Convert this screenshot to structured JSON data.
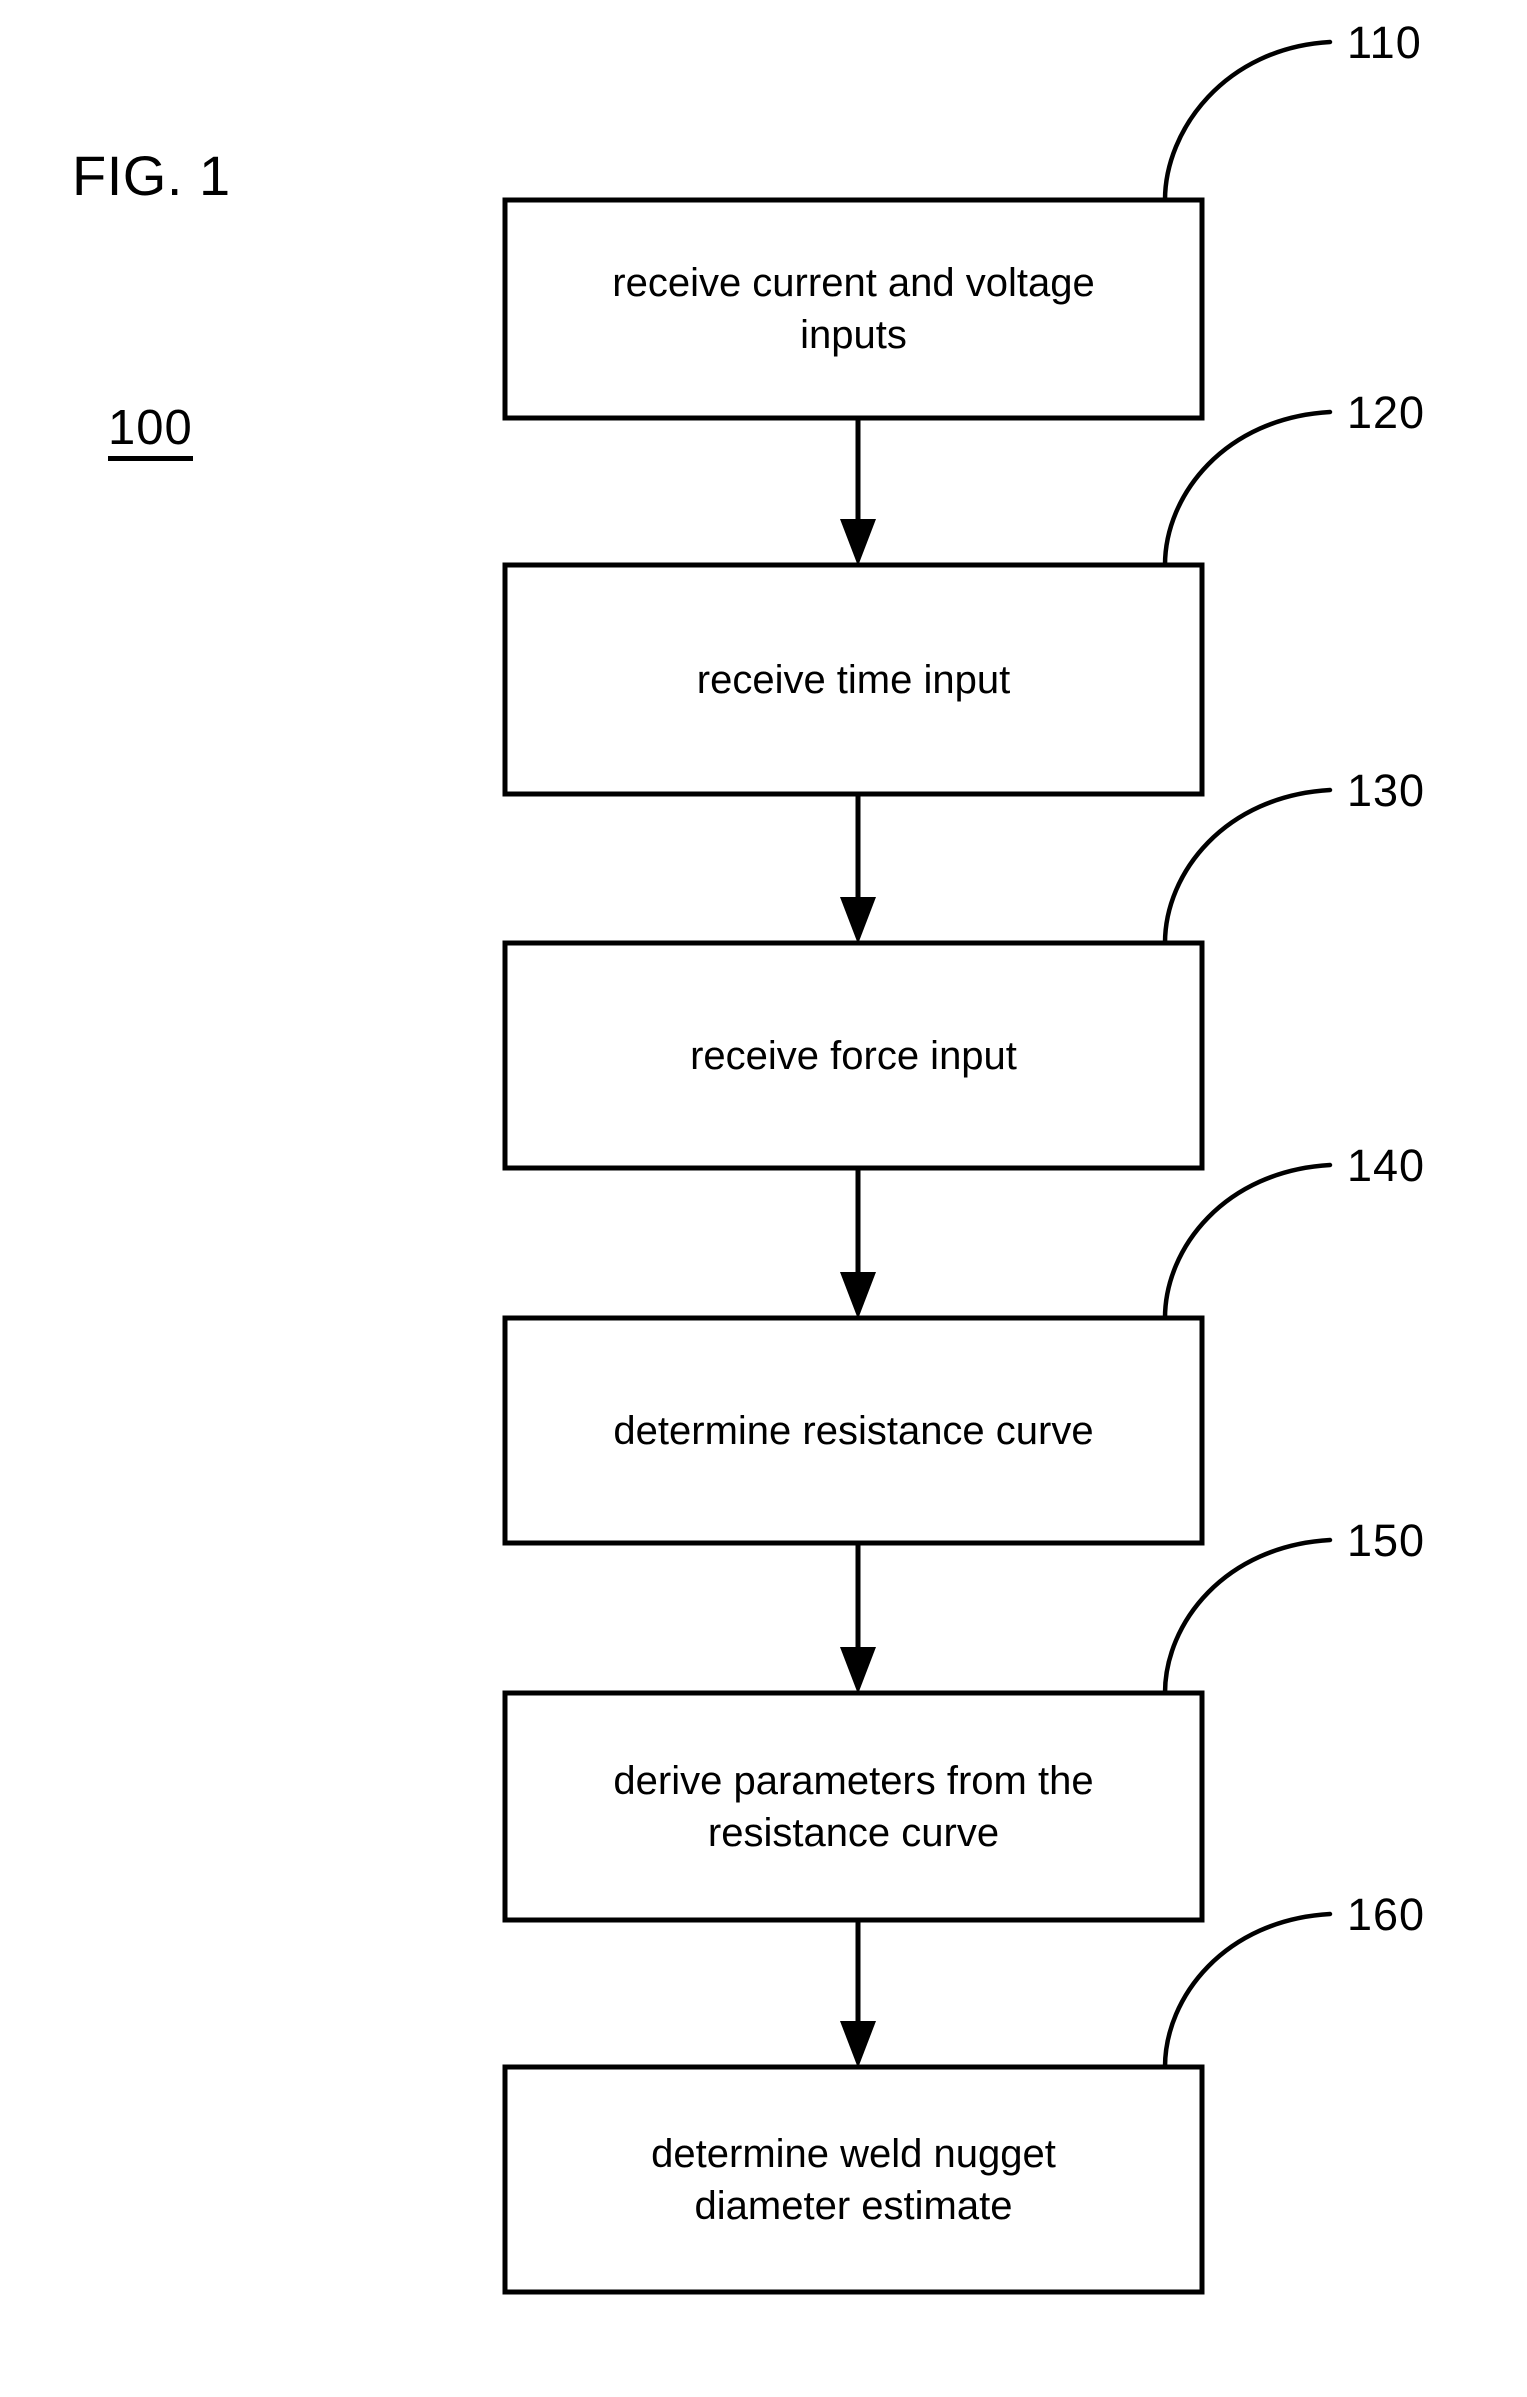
{
  "figure": {
    "caption": "FIG. 1",
    "flow_reference": "100"
  },
  "flowchart": {
    "type": "vertical-flowchart",
    "orientation": "top-to-bottom",
    "steps": [
      {
        "ref": "110",
        "label": "receive current and voltage inputs",
        "lines": [
          "receive current and voltage",
          "inputs"
        ]
      },
      {
        "ref": "120",
        "label": "receive time input",
        "lines": [
          "receive time input"
        ]
      },
      {
        "ref": "130",
        "label": "receive force input",
        "lines": [
          "receive force input"
        ]
      },
      {
        "ref": "140",
        "label": "determine resistance curve",
        "lines": [
          "determine resistance curve"
        ]
      },
      {
        "ref": "150",
        "label": "derive parameters from the resistance curve",
        "lines": [
          "derive parameters from the",
          "resistance curve"
        ]
      },
      {
        "ref": "160",
        "label": "determine weld nugget diameter estimate",
        "lines": [
          "determine weld nugget",
          "diameter estimate"
        ]
      }
    ],
    "connectors": [
      {
        "from": "110",
        "to": "120",
        "style": "arrow-down"
      },
      {
        "from": "120",
        "to": "130",
        "style": "arrow-down"
      },
      {
        "from": "130",
        "to": "140",
        "style": "arrow-down"
      },
      {
        "from": "140",
        "to": "150",
        "style": "arrow-down"
      },
      {
        "from": "150",
        "to": "160",
        "style": "arrow-down"
      }
    ]
  },
  "style": {
    "line_color": "#000000",
    "box_fill": "#ffffff",
    "background": "#ffffff"
  }
}
